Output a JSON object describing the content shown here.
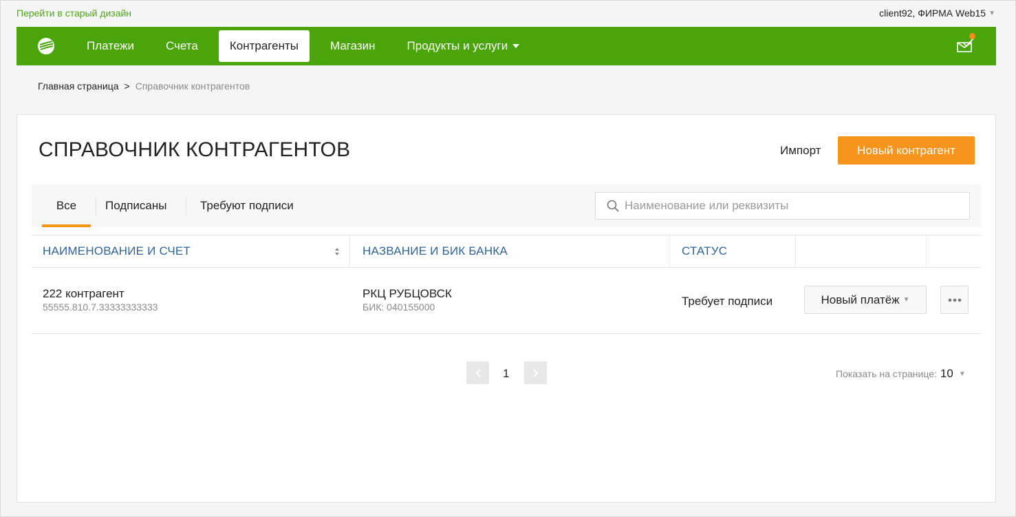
{
  "topbar": {
    "old_design_link": "Перейти в старый дизайн",
    "user": "client92, ФИРМА Web15"
  },
  "nav": {
    "items": [
      {
        "label": "Платежи"
      },
      {
        "label": "Счета"
      },
      {
        "label": "Контрагенты",
        "active": true
      },
      {
        "label": "Магазин"
      },
      {
        "label": "Продукты и услуги",
        "dropdown": true
      }
    ],
    "brand_color": "#4aa50b",
    "notification_icon": "mail-check-icon",
    "notification_dot_color": "#ff8c1a"
  },
  "breadcrumb": {
    "home": "Главная страница",
    "separator": ">",
    "current": "Справочник контрагентов"
  },
  "page": {
    "title": "СПРАВОЧНИК КОНТРАГЕНТОВ",
    "import_label": "Импорт",
    "new_button_label": "Новый контрагент",
    "accent_color": "#f7941d"
  },
  "tabs": [
    {
      "label": "Все",
      "active": true
    },
    {
      "label": "Подписаны"
    },
    {
      "label": "Требуют подписи"
    }
  ],
  "search": {
    "placeholder": "Наименование или реквизиты",
    "value": ""
  },
  "table": {
    "columns": [
      "НАИМЕНОВАНИЕ И СЧЕТ",
      "НАЗВАНИЕ И БИК БАНКА",
      "СТАТУС"
    ],
    "rows": [
      {
        "name": "222 контрагент",
        "account": "55555.810.7.33333333333",
        "bank": "РКЦ РУБЦОВСК",
        "bik": "БИК: 040155000",
        "status": "Требует подписи",
        "action_label": "Новый платёж"
      }
    ]
  },
  "pagination": {
    "current_page": "1",
    "per_page_label": "Показать на странице:",
    "per_page_value": "10"
  }
}
